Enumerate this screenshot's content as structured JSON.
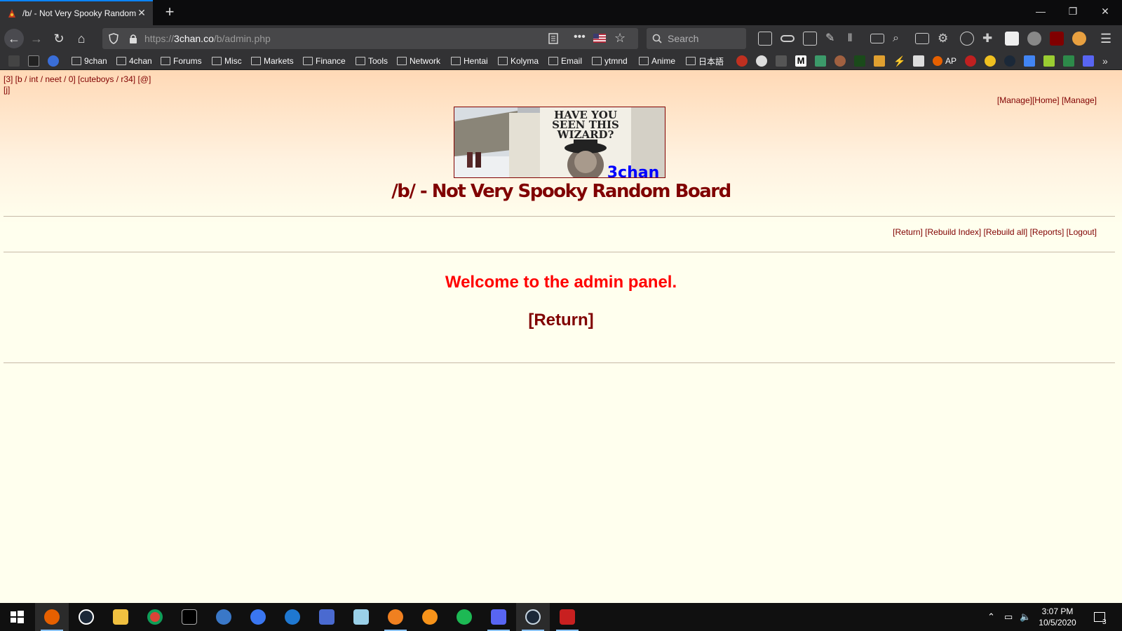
{
  "browser": {
    "tab_title": "/b/ - Not Very Spooky Random Board",
    "url_domain": "3chan.co",
    "url_prefix": "https://",
    "url_path": "/b/admin.php",
    "search_placeholder": "Search",
    "bookmarks": [
      "9chan",
      "4chan",
      "Forums",
      "Misc",
      "Markets",
      "Finance",
      "Tools",
      "Network",
      "Hentai",
      "Kolyma",
      "Email",
      "ytmnd",
      "Anime",
      "日本語"
    ],
    "bookmark_ap": "AP"
  },
  "page": {
    "boardlist_line1": "[3] [b / int / neet / 0] [cuteboys / r34] [@]",
    "boardlist_line2": "[j]",
    "adminbar": "[Manage][Home] [Manage]",
    "banner_text": "HAVE YOU SEEN THIS WIZARD?",
    "banner_logo": "3chan",
    "board_title": "/b/ - Not Very Spooky Random Board",
    "manage_links": "[Return] [Rebuild Index] [Rebuild all] [Reports] [Logout]",
    "welcome_message": "Welcome to the admin panel.",
    "return_link": "[Return]"
  },
  "taskbar": {
    "time": "3:07 PM",
    "date": "10/5/2020",
    "notifications": "3"
  },
  "colors": {
    "accent": "#800000",
    "welcome": "#ff0000",
    "background": "#ffffee"
  }
}
